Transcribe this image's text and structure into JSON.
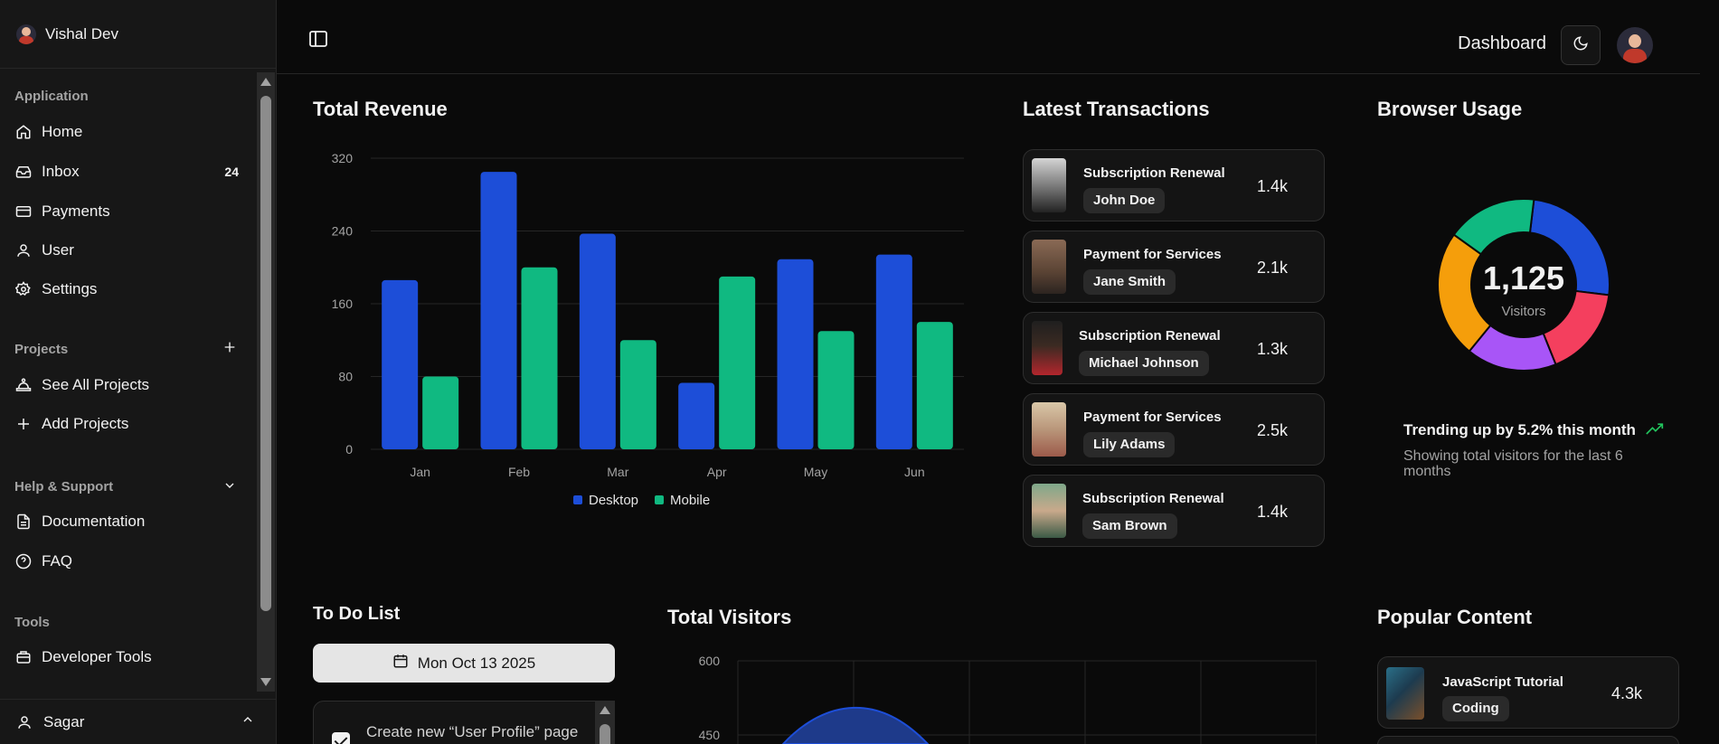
{
  "sidebar": {
    "user_name": "Vishal Dev",
    "groups": {
      "application": "Application",
      "projects": "Projects",
      "help": "Help & Support",
      "tools": "Tools"
    },
    "items": [
      {
        "label": "Home",
        "icon": "home-icon"
      },
      {
        "label": "Inbox",
        "icon": "inbox-icon",
        "badge": "24"
      },
      {
        "label": "Payments",
        "icon": "credit-card-icon"
      },
      {
        "label": "User",
        "icon": "user-icon"
      },
      {
        "label": "Settings",
        "icon": "gear-icon"
      }
    ],
    "project_items": [
      {
        "label": "See All Projects",
        "icon": "projects-icon"
      },
      {
        "label": "Add Projects",
        "icon": "plus-icon"
      }
    ],
    "help_items": [
      {
        "label": "Documentation",
        "icon": "document-icon"
      },
      {
        "label": "FAQ",
        "icon": "help-circle-icon"
      }
    ],
    "tool_items": [
      {
        "label": "Developer Tools",
        "icon": "toolbox-icon"
      }
    ],
    "footer_user": "Sagar"
  },
  "header": {
    "title": "Dashboard"
  },
  "revenue": {
    "title": "Total Revenue",
    "legend": [
      "Desktop",
      "Mobile"
    ]
  },
  "chart_data": {
    "type": "bar",
    "title": "Total Revenue",
    "categories": [
      "Jan",
      "Feb",
      "Mar",
      "Apr",
      "May",
      "Jun"
    ],
    "series": [
      {
        "name": "Desktop",
        "values": [
          186,
          305,
          237,
          73,
          209,
          214
        ],
        "color": "#1d4ed8"
      },
      {
        "name": "Mobile",
        "values": [
          80,
          200,
          120,
          190,
          130,
          140
        ],
        "color": "#10b981"
      }
    ],
    "yticks": [
      0,
      80,
      160,
      240,
      320
    ],
    "ylim": [
      0,
      320
    ],
    "legend": "bottom",
    "grid": true
  },
  "transactions": {
    "title": "Latest Transactions",
    "items": [
      {
        "title": "Subscription Renewal",
        "name": "John Doe",
        "amount": "1.4k"
      },
      {
        "title": "Payment for Services",
        "name": "Jane Smith",
        "amount": "2.1k"
      },
      {
        "title": "Subscription Renewal",
        "name": "Michael Johnson",
        "amount": "1.3k"
      },
      {
        "title": "Payment for Services",
        "name": "Lily Adams",
        "amount": "2.5k"
      },
      {
        "title": "Subscription Renewal",
        "name": "Sam Brown",
        "amount": "1.4k"
      }
    ]
  },
  "browser": {
    "title": "Browser Usage",
    "total": "1,125",
    "total_label": "Visitors",
    "trend": "Trending up by 5.2% this month",
    "subtitle": "Showing total visitors for the last 6 months",
    "slices": [
      {
        "color": "#1d4ed8",
        "value": 0.25
      },
      {
        "color": "#f43f5e",
        "value": 0.17
      },
      {
        "color": "#a855f7",
        "value": 0.17
      },
      {
        "color": "#f59e0b",
        "value": 0.24
      },
      {
        "color": "#10b981",
        "value": 0.17
      }
    ]
  },
  "todo": {
    "title": "To Do List",
    "date": "Mon Oct 13 2025",
    "items": [
      {
        "text": "Create new “User Profile” page",
        "checked": true
      }
    ]
  },
  "visitors": {
    "title": "Total Visitors",
    "yticks": [
      "600",
      "450"
    ]
  },
  "popular": {
    "title": "Popular Content",
    "items": [
      {
        "title": "JavaScript Tutorial",
        "tag": "Coding",
        "amount": "4.3k"
      }
    ]
  }
}
